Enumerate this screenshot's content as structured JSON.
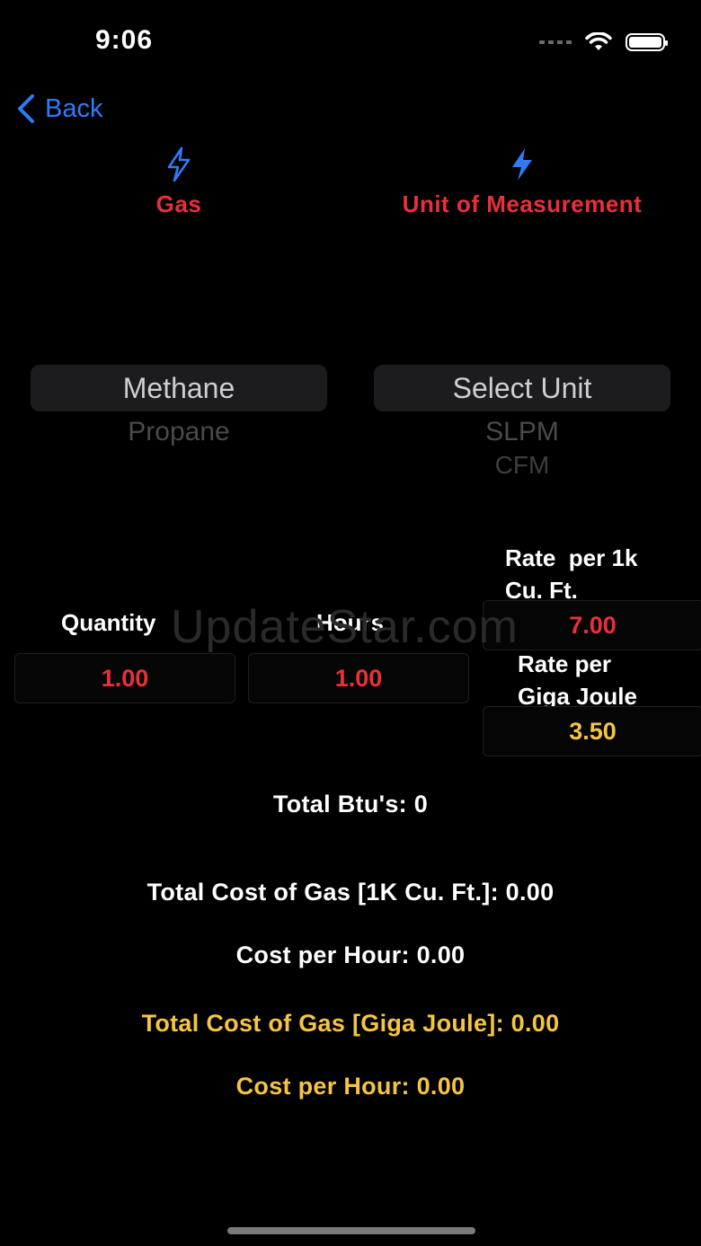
{
  "status": {
    "time": "9:06"
  },
  "nav": {
    "back_label": "Back"
  },
  "headers": {
    "gas": "Gas",
    "unit": "Unit of Measurement"
  },
  "gas_picker": {
    "selected": "Methane",
    "options": [
      "Propane"
    ]
  },
  "unit_picker": {
    "selected": "Select Unit",
    "options": [
      "SLPM",
      "CFM"
    ]
  },
  "inputs": {
    "quantity_label": "Quantity",
    "quantity_value": "1.00",
    "hours_label": "Hours",
    "hours_value": "1.00",
    "rate_cuft_label_line1": "Rate  per 1k",
    "rate_cuft_label_line2": "Cu. Ft.",
    "rate_cuft_value": "7.00",
    "rate_gj_label_line1": "Rate per",
    "rate_gj_label_line2": "Giga Joule",
    "rate_gj_value": "3.50"
  },
  "results": {
    "total_btu": "Total Btu's: 0",
    "total_cost_cuft": "Total Cost of Gas [1K Cu. Ft.]: 0.00",
    "cost_per_hour_cuft": "Cost per Hour: 0.00",
    "total_cost_gj": "Total Cost of Gas [Giga Joule]: 0.00",
    "cost_per_hour_gj": "Cost per Hour: 0.00"
  },
  "watermark": "UpdateStar.com",
  "colors": {
    "accent_blue": "#2f7cf6",
    "value_red": "#e8303a",
    "value_yellow": "#f5c542",
    "background": "#000000"
  }
}
